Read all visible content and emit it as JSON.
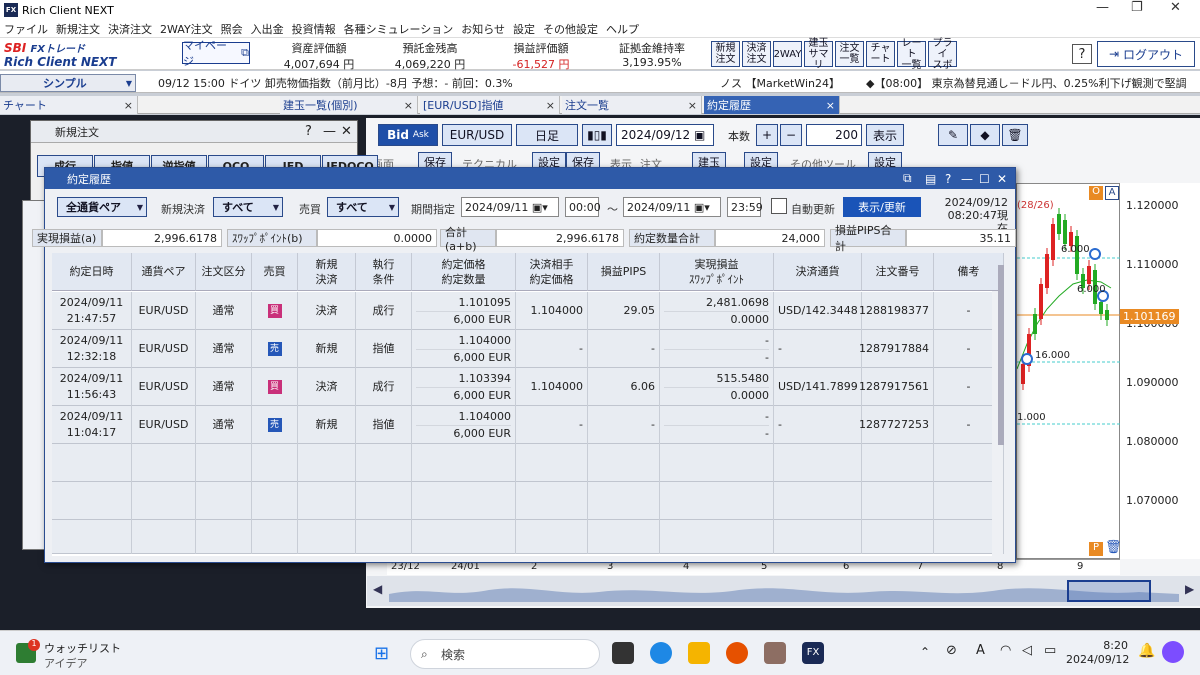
{
  "app": {
    "title": "Rich Client NEXT",
    "logo": "FX"
  },
  "menu": [
    "ファイル",
    "新規注文",
    "決済注文",
    "2WAY注文",
    "照会",
    "入出金",
    "投資情報",
    "各種シミュレーション",
    "お知らせ",
    "設定",
    "その他設定",
    "ヘルプ"
  ],
  "header": {
    "brand_prefix": "SBI",
    "brand_mid": "FXトレード",
    "brand_name": "Rich Client NEXT",
    "mypage": "マイページ",
    "stats": [
      {
        "label": "資産評価額",
        "value": "4,007,694 円"
      },
      {
        "label": "預託金残高",
        "value": "4,069,220 円"
      },
      {
        "label": "損益評価額",
        "value": "-61,527 円",
        "color": "#d42020"
      },
      {
        "label": "証拠金維持率",
        "value": "3,193.95%"
      }
    ],
    "tools": [
      [
        "新規",
        "注文"
      ],
      [
        "決済",
        "注文"
      ],
      [
        "2WAY",
        ""
      ],
      [
        "建玉",
        "サマリ"
      ],
      [
        "注文",
        "一覧"
      ],
      [
        "チャ",
        "ート"
      ],
      [
        "レート",
        "一覧"
      ],
      [
        "プライ",
        "スボ"
      ]
    ],
    "help": "?",
    "logout": "ログアウト"
  },
  "ticker": {
    "mode": "シンプル",
    "news1": "09/12 15:00 ドイツ 卸売物価指数（前月比）-8月 予想：- 前回：0.3%",
    "news2": "ノス 【MarketWin24】",
    "news3": "◆【08:00】 東京為替見通し－ドル円、0.25%利下げ観測で堅調"
  },
  "tabs": [
    {
      "label": "チャート"
    },
    {
      "label": "建玉一覧(個別)"
    },
    {
      "label": "[EUR/USD]指値"
    },
    {
      "label": "注文一覧"
    },
    {
      "label": "約定履歴"
    }
  ],
  "chart": {
    "bid": "Bid",
    "ask": "Ask",
    "pair": "EUR/USD",
    "tf": "日足",
    "date": "2024/09/12",
    "count_label": "本数",
    "count": "200",
    "show": "表示",
    "plus": "+",
    "minus": "−",
    "row2": [
      "画面",
      "保存",
      "テクニカル",
      "設定",
      "保存",
      "表示",
      "注文",
      "建玉",
      "設定",
      "その他ツール",
      "設定"
    ],
    "price_tag": "1.101169",
    "yticks": [
      "1.120000",
      "1.110000",
      "1.100000",
      "1.090000",
      "1.080000",
      "1.070000"
    ],
    "xticks": [
      "23/12",
      "24/01",
      "2",
      "3",
      "4",
      "5",
      "6",
      "7",
      "8",
      "9"
    ],
    "annos": [
      "6.000",
      "16.000",
      "6.000",
      "1.000",
      "(28/26)"
    ],
    "icons": [
      "O",
      "A",
      "P"
    ]
  },
  "neworder": {
    "title": "新規注文",
    "tabs": [
      "成行",
      "指値",
      "逆指値",
      "OCO",
      "IFD",
      "IFDOCO"
    ],
    "q": "?"
  },
  "history": {
    "title": "約定履歴",
    "filter": {
      "pair": "全通貨ペア",
      "settle_label": "新規決済",
      "settle": "すべて",
      "side_label": "売買",
      "side": "すべて",
      "period_label": "期間指定",
      "from_date": "2024/09/11",
      "from_time": "00:00",
      "tilde": "～",
      "to_date": "2024/09/11",
      "to_time": "23:59",
      "auto": "自動更新",
      "show": "表示/更新",
      "asof1": "2024/09/12",
      "asof2": "08:20:47現在"
    },
    "summary": [
      {
        "label": "実現損益(a)",
        "value": "2,996.6178"
      },
      {
        "label": "ｽﾜｯﾌﾟﾎﾟｲﾝﾄ(b)",
        "value": "0.0000"
      },
      {
        "label": "合計(a+b)",
        "value": "2,996.6178"
      },
      {
        "label": "約定数量合計",
        "value": "24,000"
      },
      {
        "label": "損益PIPS合計",
        "value": "35.11"
      }
    ],
    "headers": [
      [
        "約定日時",
        ""
      ],
      [
        "通貨ペア",
        ""
      ],
      [
        "注文区分",
        ""
      ],
      [
        "売買",
        ""
      ],
      [
        "新規",
        "決済"
      ],
      [
        "執行",
        "条件"
      ],
      [
        "約定価格",
        "約定数量"
      ],
      [
        "決済相手",
        "約定価格"
      ],
      [
        "損益PIPS",
        ""
      ],
      [
        "実現損益",
        "ｽﾜｯﾌﾟﾎﾟｲﾝﾄ"
      ],
      [
        "決済通貨",
        ""
      ],
      [
        "注文番号",
        ""
      ],
      [
        "備考",
        ""
      ]
    ],
    "rows": [
      {
        "date": "2024/09/11",
        "time": "21:47:57",
        "pair": "EUR/USD",
        "kind": "通常",
        "side": "買",
        "side_type": "buy",
        "ns": "決済",
        "cond": "成行",
        "price": "1.101095",
        "qty": "6,000 EUR",
        "cp": "1.104000",
        "pips": "29.05",
        "pl": "2,481.0698",
        "swap": "0.0000",
        "cur": "USD/142.3448",
        "no": "1288198377",
        "note": "-"
      },
      {
        "date": "2024/09/11",
        "time": "12:32:18",
        "pair": "EUR/USD",
        "kind": "通常",
        "side": "売",
        "side_type": "sell",
        "ns": "新規",
        "cond": "指値",
        "price": "1.104000",
        "qty": "6,000 EUR",
        "cp": "-",
        "pips": "-",
        "pl": "-",
        "swap": "-",
        "cur": "-",
        "no": "1287917884",
        "note": "-"
      },
      {
        "date": "2024/09/11",
        "time": "11:56:43",
        "pair": "EUR/USD",
        "kind": "通常",
        "side": "買",
        "side_type": "buy",
        "ns": "決済",
        "cond": "成行",
        "price": "1.103394",
        "qty": "6,000 EUR",
        "cp": "1.104000",
        "pips": "6.06",
        "pl": "515.5480",
        "swap": "0.0000",
        "cur": "USD/141.7899",
        "no": "1287917561",
        "note": "-"
      },
      {
        "date": "2024/09/11",
        "time": "11:04:17",
        "pair": "EUR/USD",
        "kind": "通常",
        "side": "売",
        "side_type": "sell",
        "ns": "新規",
        "cond": "指値",
        "price": "1.104000",
        "qty": "6,000 EUR",
        "cp": "-",
        "pips": "-",
        "pl": "-",
        "swap": "-",
        "cur": "-",
        "no": "1287727253",
        "note": "-"
      }
    ]
  },
  "taskbar": {
    "watch1": "ウォッチリスト",
    "watch2": "アイデア",
    "badge": "1",
    "search": "検索",
    "ime": "A",
    "time": "8:20",
    "date": "2024/09/12"
  }
}
